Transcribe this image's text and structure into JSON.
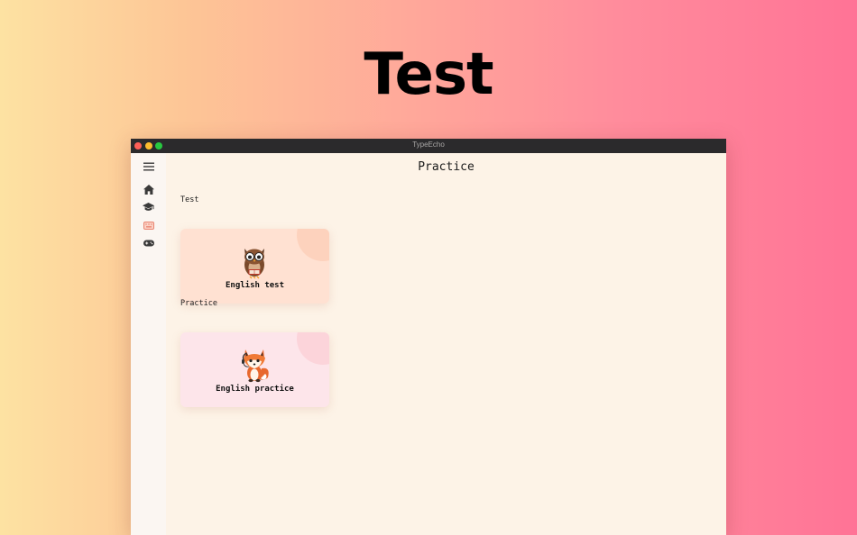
{
  "hero": {
    "title": "Test"
  },
  "window": {
    "title": "TypeEcho"
  },
  "sidebar": {
    "items": [
      {
        "name": "menu",
        "icon": "menu-icon",
        "active": false
      },
      {
        "name": "home",
        "icon": "home-icon",
        "active": false
      },
      {
        "name": "learn",
        "icon": "graduation-cap-icon",
        "active": false
      },
      {
        "name": "typing",
        "icon": "keyboard-icon",
        "active": true
      },
      {
        "name": "games",
        "icon": "gamepad-icon",
        "active": false
      }
    ]
  },
  "main": {
    "title": "Practice",
    "sections": [
      {
        "label": "Test",
        "card": {
          "label": "English test",
          "icon": "owl-icon"
        }
      },
      {
        "label": "Practice",
        "card": {
          "label": "English practice",
          "icon": "fox-icon"
        }
      }
    ]
  },
  "colors": {
    "accent": "#e9836f",
    "sidebar_bg": "#fbf6f2",
    "content_bg": "#fdf3e7",
    "test_card_bg": "#ffe1d2",
    "practice_card_bg": "#fde5ea"
  }
}
